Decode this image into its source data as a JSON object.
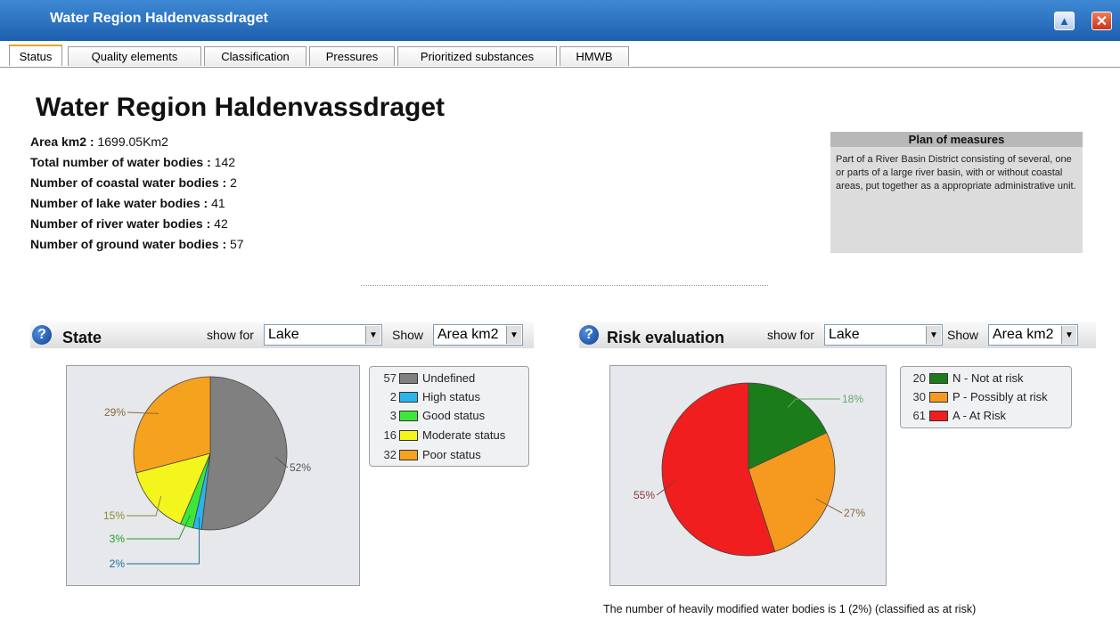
{
  "window": {
    "title": "Water Region Haldenvassdraget",
    "close_symbol": "✕",
    "collapse_symbol": "▲"
  },
  "tabs": [
    "Status",
    "Quality elements",
    "Classification",
    "Pressures",
    "Prioritized substances",
    "HMWB"
  ],
  "page": {
    "heading": "Water Region Haldenvassdraget",
    "facts": [
      {
        "label": "Area km2 :",
        "value": "1699.05Km2"
      },
      {
        "label": "Total number of water bodies :",
        "value": "142"
      },
      {
        "label": "Number of coastal water bodies :",
        "value": "2"
      },
      {
        "label": "Number of lake water bodies :",
        "value": "41"
      },
      {
        "label": "Number of river water bodies :",
        "value": "42"
      },
      {
        "label": "Number of ground water bodies :",
        "value": "57"
      }
    ]
  },
  "plan": {
    "title": "Plan of measures",
    "text": "Part of a River Basin District consisting of several, one or parts of a large river basin, with or without coastal areas, put together as a appropriate administrative unit."
  },
  "state_panel": {
    "title": "State",
    "show_for_label": "show for",
    "show_for_value": "Lake",
    "show_label": "Show",
    "show_value": "Area km2",
    "help_symbol": "?"
  },
  "risk_panel": {
    "title": "Risk evaluation",
    "show_for_label": "show for",
    "show_for_value": "Lake",
    "show_label": "Show",
    "show_value": "Area km2",
    "help_symbol": "?"
  },
  "footnote": "The number of heavily modified water bodies is 1 (2%) (classified as at risk)",
  "chart_data": [
    {
      "type": "pie",
      "categories": [
        "Undefined",
        "High status",
        "Good status",
        "Moderate status",
        "Poor status"
      ],
      "values": [
        57,
        2,
        3,
        16,
        32
      ],
      "percent_labels": [
        "52%",
        "2%",
        "3%",
        "15%",
        "29%"
      ],
      "colors": [
        "#808080",
        "#2ab4e8",
        "#3ee63a",
        "#f5f51e",
        "#f5a21e"
      ],
      "label_colors": [
        "#555555",
        "#1a6f9a",
        "#2a9a2a",
        "#8a8a30",
        "#8a6a3a"
      ]
    },
    {
      "type": "pie",
      "categories": [
        "N - Not at risk",
        "P - Possibly at risk",
        "A - At Risk"
      ],
      "values": [
        20,
        30,
        61
      ],
      "percent_labels": [
        "18%",
        "27%",
        "55%"
      ],
      "colors": [
        "#1a7d1a",
        "#f59a1e",
        "#f01e1e"
      ],
      "label_colors": [
        "#6aa86a",
        "#8a6a3a",
        "#8a3a3a"
      ]
    }
  ]
}
